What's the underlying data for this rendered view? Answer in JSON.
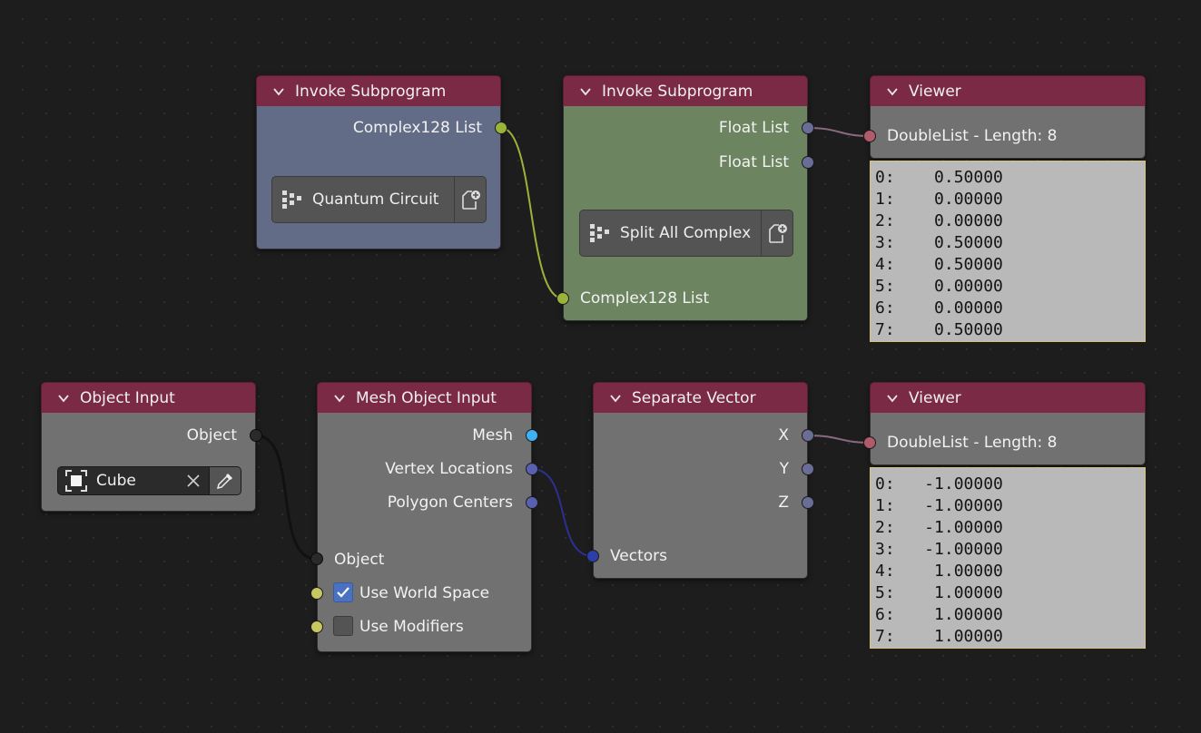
{
  "colors": {
    "background": "#1d1d1d",
    "header": "#7b2a46",
    "node_gray": "#717171",
    "node_blue": "#636c86",
    "node_green": "#6c8460",
    "viewer_list_bg": "#b9b9b9",
    "checkbox_checked": "#4b72c0"
  },
  "invoke_1": {
    "title": "Invoke Subprogram",
    "output": "Complex128 List",
    "button_label": "Quantum Circuit",
    "button_icon": "node-tree-icon",
    "side_icon": "new-file-icon"
  },
  "invoke_2": {
    "title": "Invoke Subprogram",
    "outputs": [
      "Float List",
      "Float List"
    ],
    "button_label": "Split All Complex",
    "button_icon": "node-tree-icon",
    "side_icon": "new-file-icon",
    "input": "Complex128 List"
  },
  "viewer_1": {
    "title": "Viewer",
    "info": "DoubleList - Length: 8",
    "rows": [
      "0:    0.50000",
      "1:    0.00000",
      "2:    0.00000",
      "3:    0.50000",
      "4:    0.50000",
      "5:    0.00000",
      "6:    0.00000",
      "7:    0.50000"
    ]
  },
  "object_input": {
    "title": "Object Input",
    "output": "Object",
    "field_value": "Cube",
    "clear_icon": "close-icon",
    "picker_icon": "eyedropper-icon"
  },
  "mesh_object_input": {
    "title": "Mesh Object Input",
    "outputs": [
      "Mesh",
      "Vertex Locations",
      "Polygon Centers"
    ],
    "input": "Object",
    "use_world_space": {
      "label": "Use World Space",
      "checked": true
    },
    "use_modifiers": {
      "label": "Use Modifiers",
      "checked": false
    }
  },
  "separate_vector": {
    "title": "Separate Vector",
    "outputs": [
      "X",
      "Y",
      "Z"
    ],
    "input": "Vectors"
  },
  "viewer_2": {
    "title": "Viewer",
    "info": "DoubleList - Length: 8",
    "rows": [
      "0:   -1.00000",
      "1:   -1.00000",
      "2:   -1.00000",
      "3:   -1.00000",
      "4:    1.00000",
      "5:    1.00000",
      "6:    1.00000",
      "7:    1.00000"
    ]
  }
}
